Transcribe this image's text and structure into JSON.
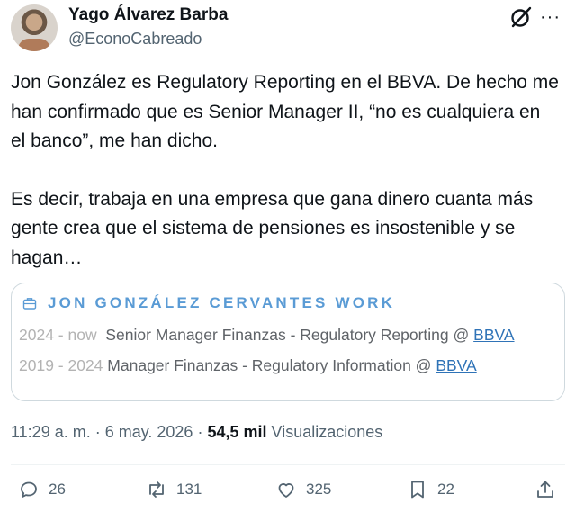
{
  "author": {
    "name": "Yago Álvarez Barba",
    "handle": "@EconoCabreado",
    "avatar_icon": "profile-photo"
  },
  "header_icons": {
    "grok": "grok-icon",
    "more": "more-icon",
    "more_glyph": "···"
  },
  "tweet": {
    "paragraph_1": "Jon González es Regulatory Reporting en el BBVA. De hecho me han confirmado que es Senior Manager II, “no es cualquiera en el banco”, me han dicho.",
    "paragraph_2": "Es decir, trabaja en una empresa que gana dinero cuanta más gente crea que el sistema de pensiones es insostenible y se hagan…"
  },
  "card": {
    "title": "JON GONZÁLEZ CERVANTES WORK",
    "title_icon": "briefcase-icon",
    "jobs": [
      {
        "years": "2024 - now",
        "role": "Senior Manager Finanzas - Regulatory Reporting @ ",
        "company": "BBVA"
      },
      {
        "years": "2019 - 2024",
        "role": "Manager Finanzas - Regulatory Information @ ",
        "company": "BBVA"
      }
    ]
  },
  "meta": {
    "time": "11:29 a. m.",
    "sep": " · ",
    "date": "6 may. 2026",
    "views_count": "54,5 mil",
    "views_label": "Visualizaciones"
  },
  "actions": {
    "replies": "26",
    "reposts": "131",
    "likes": "325",
    "bookmarks": "22"
  },
  "colors": {
    "text": "#0f1419",
    "secondary": "#536471",
    "card_title": "#5a9bd5",
    "link": "#2f73b7"
  }
}
